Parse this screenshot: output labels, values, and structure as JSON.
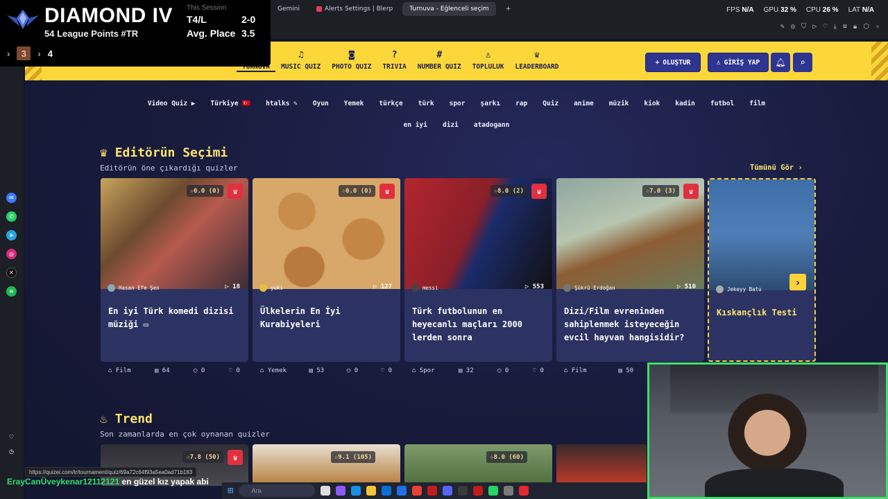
{
  "overlay": {
    "rank_tier": "DIAMOND IV",
    "league_points": "54 League Points #TR",
    "session_title": "This Session",
    "wl_label": "T4/L",
    "wl_value": "2-0",
    "avg_label": "Avg. Place",
    "avg_value": "3.5",
    "page_current": "3",
    "page_next": "4"
  },
  "browser": {
    "tabs": [
      {
        "label": "Gemini",
        "active": false
      },
      {
        "label": "Alerts Settings | Blerp",
        "active": false
      },
      {
        "label": "Turnuva - Eğlenceli seçim",
        "active": true
      }
    ],
    "new_tab": "+",
    "perf": {
      "fps_label": "FPS",
      "fps": "N/A",
      "gpu_label": "GPU",
      "gpu": "32 %",
      "cpu_label": "CPU",
      "cpu": "26 %",
      "lat_label": "LAT",
      "lat": "N/A"
    },
    "status_url": "https://quizei.com/tr/tournament/quiz/69a72c64f93a5ea0ad71b183"
  },
  "nav": {
    "links": [
      {
        "label": "TURNUVA",
        "icon": "trophy-icon"
      },
      {
        "label": "MUSIC QUIZ",
        "icon": "music-note-icon"
      },
      {
        "label": "PHOTO QUIZ",
        "icon": "camera-icon"
      },
      {
        "label": "TRIVIA",
        "icon": "question-bubble-icon"
      },
      {
        "label": "NUMBER QUIZ",
        "icon": "hash-icon"
      },
      {
        "label": "TOPLULUK",
        "icon": "users-icon"
      },
      {
        "label": "LEADERBOARD",
        "icon": "trophy-icon"
      }
    ],
    "create_label": "OLUŞTUR",
    "login_label": "GİRİŞ YAP"
  },
  "chips": [
    "Video Quiz ▶",
    "Türkiye 🇹🇷",
    "htalks ✎",
    "Oyun",
    "Yemek",
    "türkçe",
    "türk",
    "spor",
    "şarkı",
    "rap",
    "Quiz",
    "anime",
    "müzik",
    "kiok",
    "kadin",
    "futbol",
    "film",
    "en iyi",
    "dizi",
    "atadogann"
  ],
  "editor": {
    "title": "Editörün Seçimi",
    "subtitle": "Editörün öne çıkardığı quizler",
    "see_all": "Tümünü Gör ›"
  },
  "cards": [
    {
      "rating": "☆0.0 (0)",
      "author": "Hasan Efe Şen",
      "plays": "▷ 18",
      "title": "En iyi Türk komedi dizisi müziği ▭",
      "category": "Film",
      "questions": "64",
      "comments": "0",
      "likes": "0"
    },
    {
      "rating": "☆0.0 (0)",
      "author": "yuki",
      "plays": "▷ 127",
      "title": "Ülkelerin En İyi Kurabiyeleri",
      "category": "Yemek",
      "questions": "53",
      "comments": "0",
      "likes": "0"
    },
    {
      "rating": "☆8.0 (2)",
      "author": "messi",
      "plays": "▷ 553",
      "title": "Türk futbolunun en heyecanlı maçları 2000 lerden sonra",
      "category": "Spor",
      "questions": "32",
      "comments": "0",
      "likes": "0"
    },
    {
      "rating": "☆7.0 (3)",
      "author": "Şükrü Erdoğan",
      "plays": "▷ 510",
      "title": "Dizi/Film evreninden sahiplenmek isteyeceğin evcil hayvan hangisidir?",
      "category": "Film",
      "questions": "50",
      "comments": "",
      "likes": ""
    },
    {
      "rating": "",
      "author": "Jekeyy Batu",
      "plays": "",
      "title": "Kıskançlık Testi",
      "category": "",
      "questions": "",
      "comments": "",
      "likes": ""
    }
  ],
  "trend": {
    "title": "Trend",
    "subtitle": "Son zamanlarda en çok oynanan quizler",
    "cards": [
      {
        "rating": "☆7.8 (50)"
      },
      {
        "rating": "☆9.1 (105)"
      },
      {
        "rating": "☆8.0 (60)"
      },
      {
        "rating": ""
      }
    ]
  },
  "chat": {
    "user": "ErayCanÜveykenar12112121",
    "message": "en güzel kız yapak abi"
  },
  "taskbar": {
    "search_placeholder": "Ara"
  },
  "colors": {
    "nav_yellow": "#fbd73a",
    "nav_blue": "#2d3590",
    "accent_yellow": "#ffe36e",
    "crown_red": "#e13040",
    "card_bg": "#2c3362"
  }
}
